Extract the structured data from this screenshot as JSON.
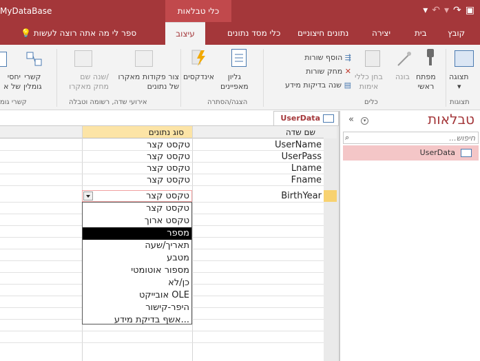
{
  "titlebar": {
    "app_name": "MyDataBase",
    "context_title": "כלי טבלאות",
    "qat_icons": [
      "save-icon",
      "undo-icon",
      "redo-icon",
      "customize-icon"
    ]
  },
  "tabs": [
    {
      "label": "קובץ"
    },
    {
      "label": "בית"
    },
    {
      "label": "יצירה"
    },
    {
      "label": "נתונים חיצוניים"
    },
    {
      "label": "כלי מסד נתונים"
    },
    {
      "label": "עיצוב"
    },
    {
      "label": "ספר לי מה אתה רוצה לעשות"
    }
  ],
  "ribbon": {
    "view_label": "תצוגה",
    "primary_key_label": "מפתח\nראשי",
    "builder_label": "בונה",
    "test_rules_label": "בחן כללי\nאימות",
    "insert_rows_label": "הוסף שורות",
    "delete_rows_label": "מחק שורות",
    "modify_lookups_label": "שנה בדיקות מידע",
    "property_sheet_label": "גליון\nמאפיינים",
    "indexes_label": "אינדקסים",
    "create_macros_label": "צור פקודות מאקרו\nשל נתונים",
    "rename_macro_label": "שנה שם/\nמחק מאקרו",
    "relationships_label": "קשרי\nגומלין",
    "object_deps_label": "יחסי\nשל א",
    "groups": {
      "views": "תצוגות",
      "tools": "כלים",
      "show_hide": "הצגה/הסתרה",
      "field_events": "אירועי שדה, רשומה וטבלה",
      "relationships": "קשרי גומ"
    }
  },
  "nav": {
    "title": "טבלאות",
    "search_placeholder": "חיפוש...",
    "items": [
      {
        "label": "UserData"
      }
    ]
  },
  "document": {
    "tab_label": "UserData",
    "columns": [
      "שם שדה",
      "סוג נתונים"
    ],
    "rows": [
      {
        "field": "UserName",
        "type": "טקסט קצר"
      },
      {
        "field": "UserPass",
        "type": "טקסט קצר"
      },
      {
        "field": "Lname",
        "type": "טקסט קצר"
      },
      {
        "field": "Fname",
        "type": "טקסט קצר"
      },
      {
        "field": "BirthYear",
        "type": "טקסט קצר"
      }
    ],
    "dropdown_options": [
      "טקסט קצר",
      "טקסט ארוך",
      "מספר",
      "תאריך/שעה",
      "מטבע",
      "מספור אוטומטי",
      "כן/לא",
      "אובייקט OLE",
      "היפר-קישור",
      "אשף בדיקת מידע..."
    ],
    "highlighted_option": "מספר"
  }
}
